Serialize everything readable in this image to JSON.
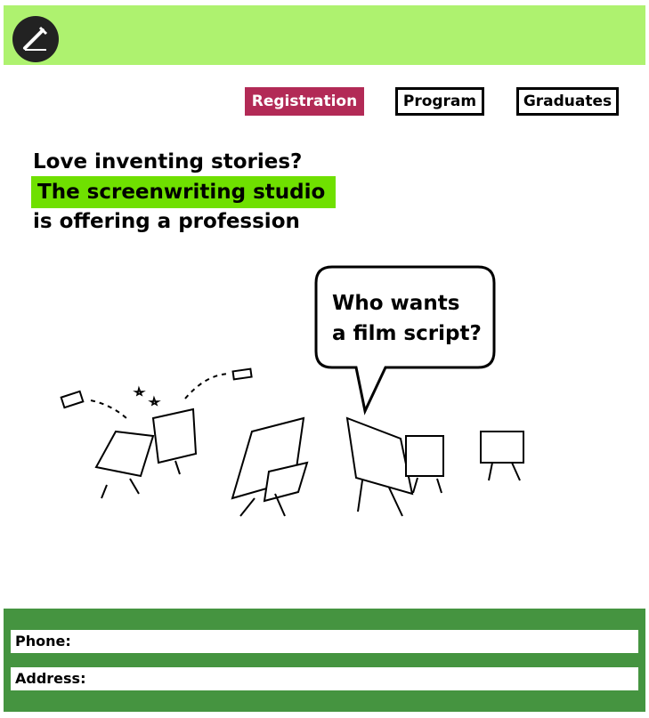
{
  "header": {
    "logo_icon": "pen-icon",
    "background": "#aef26f"
  },
  "nav": {
    "registration": "Registration",
    "program": "Program",
    "graduates": "Graduates",
    "accent": "#b22a56"
  },
  "hero": {
    "line1": "Love inventing stories?",
    "line2": "The screenwriting studio",
    "line3": "is offering a profession",
    "highlight_color": "#6fe000"
  },
  "illustration": {
    "speech_line1": "Who wants",
    "speech_line2": "a film script?"
  },
  "footer": {
    "phone_label": "Phone:",
    "address_label": "Address:",
    "background": "#459440"
  }
}
